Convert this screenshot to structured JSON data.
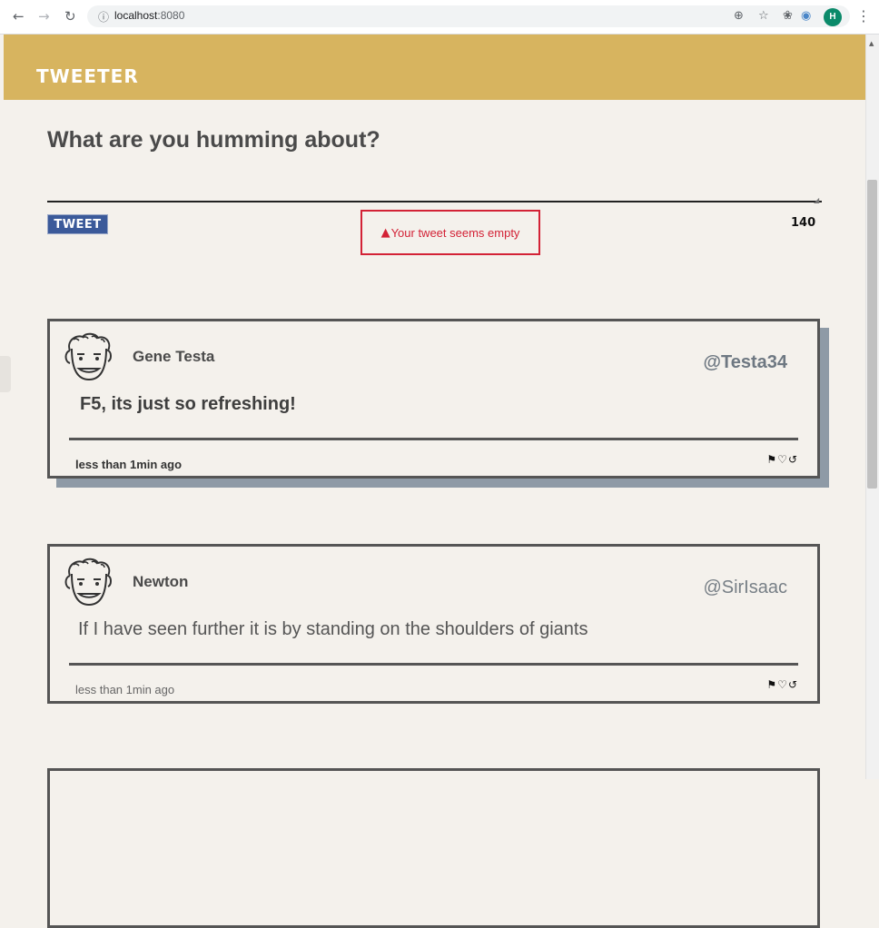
{
  "browser": {
    "url_host": "localhost",
    "url_port": ":8080",
    "avatar_initial": "H"
  },
  "header": {
    "title": "TWEETER"
  },
  "composer": {
    "heading": "What are you humming about?",
    "textarea_value": "",
    "tweet_button_label": "TWEET",
    "char_counter": "140",
    "error_message": "Your tweet seems empty"
  },
  "tweets": [
    {
      "name": "Gene Testa",
      "handle": "@Testa34",
      "content": "F5, its just so refreshing!",
      "time": "less than 1min ago",
      "hovered": true
    },
    {
      "name": "Newton",
      "handle": "@SirIsaac",
      "content": "If I have seen further it is by standing on the shoulders of giants",
      "time": "less than 1min ago",
      "hovered": false
    }
  ],
  "icons": [
    "back-arrow-icon",
    "forward-arrow-icon",
    "reload-icon",
    "info-icon",
    "zoom-icon",
    "star-icon",
    "extension-icon",
    "profile-avatar",
    "menu-icon",
    "warning-icon",
    "flag-icon",
    "heart-icon",
    "retweet-icon"
  ],
  "colors": {
    "header_bg": "#d7b45f",
    "page_bg": "#f4f1ec",
    "button_bg": "#3b5a9a",
    "error": "#d32236",
    "shadow": "#8e9aa6"
  }
}
